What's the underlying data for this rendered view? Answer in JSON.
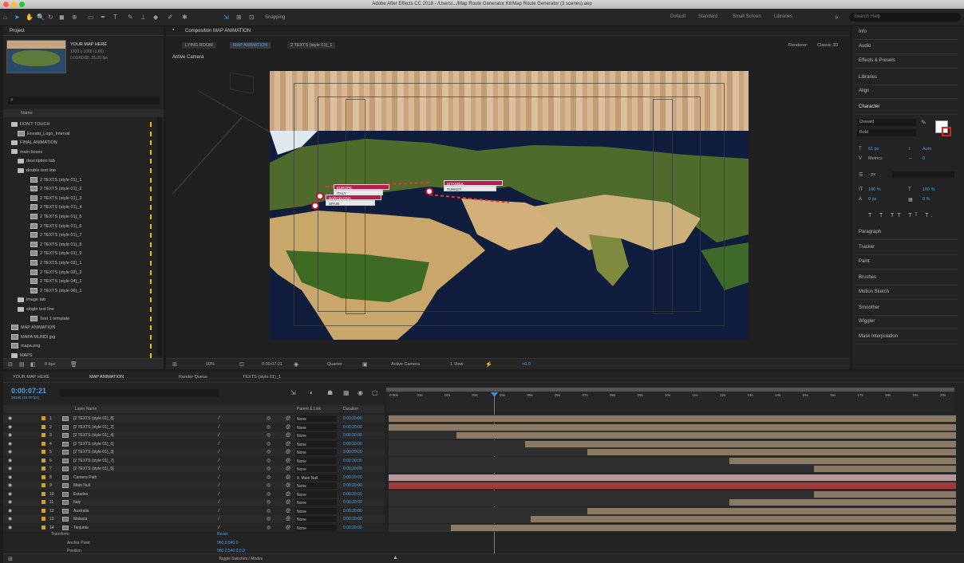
{
  "window": {
    "title": "Adobe After Effects CC 2018 - /Users/.../Map Route Generator Kit/Map Route Generator (3 scenes).aep"
  },
  "toolbar": {
    "snapping": "Snapping",
    "workspaces": [
      "Default",
      "Standard",
      "Small Screen",
      "Libraries"
    ],
    "search_placeholder": "Search Help"
  },
  "project": {
    "header": "Project",
    "thumb_title": "YOUR MAP HERE",
    "thumb_meta": "1920 x 1080 (1.00)",
    "thumb_meta2": "0:00:00:00, 25.00 fps",
    "col_name": "Name",
    "bpc": "8 bpc",
    "items": [
      {
        "type": "folder",
        "label": "DON'T TOUCH",
        "indent": 6
      },
      {
        "type": "comp",
        "label": "Envato_Logo_Interval",
        "indent": 14
      },
      {
        "type": "folder",
        "label": "FINAL ANIMATION",
        "indent": 6
      },
      {
        "type": "folder",
        "label": "main boxes",
        "indent": 6
      },
      {
        "type": "folder",
        "label": "description tab",
        "indent": 14
      },
      {
        "type": "folder",
        "label": "double text line",
        "indent": 14
      },
      {
        "type": "comp",
        "label": "2 TEXTS (style 01)_1",
        "indent": 30
      },
      {
        "type": "comp",
        "label": "2 TEXTS (style 01)_2",
        "indent": 30
      },
      {
        "type": "comp",
        "label": "2 TEXTS (style 01)_3",
        "indent": 30
      },
      {
        "type": "comp",
        "label": "2 TEXTS (style 01)_4",
        "indent": 30
      },
      {
        "type": "comp",
        "label": "2 TEXTS (style 01)_5",
        "indent": 30
      },
      {
        "type": "comp",
        "label": "2 TEXTS (style 01)_6",
        "indent": 30
      },
      {
        "type": "comp",
        "label": "2 TEXTS (style 01)_7",
        "indent": 30
      },
      {
        "type": "comp",
        "label": "2 TEXTS (style 01)_8",
        "indent": 30
      },
      {
        "type": "comp",
        "label": "2 TEXTS (style 01)_9",
        "indent": 30
      },
      {
        "type": "comp",
        "label": "2 TEXTS (style 02)_1",
        "indent": 30
      },
      {
        "type": "comp",
        "label": "2 TEXTS (style 02)_2",
        "indent": 30
      },
      {
        "type": "comp",
        "label": "2 TEXTS (style 04)_1",
        "indent": 30
      },
      {
        "type": "comp",
        "label": "2 TEXTS (style 06)_1",
        "indent": 30
      },
      {
        "type": "folder",
        "label": "image tab",
        "indent": 14
      },
      {
        "type": "folder",
        "label": "single text line",
        "indent": 14
      },
      {
        "type": "comp",
        "label": "Text 1 template",
        "indent": 30
      },
      {
        "type": "comp",
        "label": "MAP ANIMATION",
        "indent": 6
      },
      {
        "type": "comp",
        "label": "MAPA MUNDI.jpg",
        "indent": 6
      },
      {
        "type": "comp",
        "label": "mapa.png",
        "indent": 6
      },
      {
        "type": "folder",
        "label": "MAPS",
        "indent": 6
      }
    ]
  },
  "viewer": {
    "header": "Composition MAP ANIMATION",
    "crumbs": [
      "LYING ROOM",
      "MAP ANIMATION",
      "2 TEXTS (style 01)_1"
    ],
    "active_camera": "Active Camera",
    "renderer": "Renderer:",
    "renderer_value": "Classic 3D",
    "footer": {
      "zoom": "50%",
      "timecode": "0:00:07:21",
      "res": "Quarter",
      "camera": "Active Camera",
      "view": "1 View",
      "offset": "+0.0"
    },
    "tags": [
      {
        "label": "EUROPE",
        "sub": "ITALY"
      },
      {
        "label": "BARCELONA",
        "sub": "SPAIN"
      },
      {
        "label": "ISTANBUL",
        "sub": "TURKEY"
      }
    ]
  },
  "right": {
    "panels": [
      "Info",
      "Audio",
      "Effects & Presets",
      "Libraries",
      "Align",
      "Character",
      "Paragraph",
      "Tracker",
      "Paint",
      "Brushes",
      "Motion Sketch",
      "Smoother",
      "Wiggler",
      "Mask Interpolation"
    ],
    "font": "Oswald",
    "style": "Bold",
    "size": "61 px",
    "leading": "Auto",
    "kerning": "Metrics",
    "tracking": "0",
    "stroke": "- px",
    "vscale": "100 %",
    "hscale": "100 %",
    "baseline": "0 px",
    "tsume": "0 %"
  },
  "timeline": {
    "tabs": [
      "YOUR MAP HERE",
      "MAP ANIMATION",
      "Render Queue",
      "TEXTS (style 01)_1"
    ],
    "timecode": "0:00:07:21",
    "fps": "00196 (25.00 fps)",
    "col_layer": "Layer Name",
    "col_parent": "Parent & Link",
    "col_duration": "Duration",
    "toggle": "Toggle Switches / Modes",
    "ruler": [
      "0:00s",
      "01s",
      "02s",
      "03s",
      "04s",
      "05s",
      "06s",
      "07s",
      "08s",
      "09s",
      "10s",
      "11s",
      "12s",
      "13s",
      "14s",
      "15s",
      "16s",
      "17s",
      "18s",
      "19s",
      "20s"
    ],
    "layers": [
      {
        "n": "1",
        "name": "[2 TEXTS (style 01)_8]",
        "parent": "None",
        "dur": "0:00:20:00",
        "start": 0.0,
        "color": "#8a7a63"
      },
      {
        "n": "2",
        "name": "[2 TEXTS (style 01)_2]",
        "parent": "None",
        "dur": "0:00:20:00",
        "start": 0.0,
        "color": "#8a7a63"
      },
      {
        "n": "3",
        "name": "[2 TEXTS (style 01)_4]",
        "parent": "None",
        "dur": "0:00:20:00",
        "start": 0.12,
        "color": "#8a7a63"
      },
      {
        "n": "4",
        "name": "[2 TEXTS (style 01)_6]",
        "parent": "None",
        "dur": "0:00:20:00",
        "start": 0.24,
        "color": "#8a7a63"
      },
      {
        "n": "5",
        "name": "[2 TEXTS (style 01)_3]",
        "parent": "None",
        "dur": "0:00:20:00",
        "start": 0.35,
        "color": "#8a7a63"
      },
      {
        "n": "6",
        "name": "[2 TEXTS (style 01)_7]",
        "parent": "None",
        "dur": "0:00:20:00",
        "start": 0.6,
        "color": "#8a7a63"
      },
      {
        "n": "7",
        "name": "[2 TEXTS (style 01)_5]",
        "parent": "None",
        "dur": "0:00:20:00",
        "start": 0.75,
        "color": "#8a7a63"
      },
      {
        "n": "8",
        "name": "Camera Path",
        "parent": "9. Main Null",
        "dur": "0:00:20:00",
        "start": 0.0,
        "color": "#b8969a"
      },
      {
        "n": "9",
        "name": "Main Null",
        "parent": "None",
        "dur": "0:00:20:00",
        "start": 0.0,
        "color": "#a33a3a"
      },
      {
        "n": "10",
        "name": "Estados",
        "parent": "None",
        "dur": "0:00:20:00",
        "start": 0.75,
        "color": "#8a7a63"
      },
      {
        "n": "11",
        "name": "Italy",
        "parent": "None",
        "dur": "0:00:20:00",
        "start": 0.6,
        "color": "#8a7a63"
      },
      {
        "n": "12",
        "name": "Australia",
        "parent": "None",
        "dur": "0:00:20:00",
        "start": 0.35,
        "color": "#8a7a63"
      },
      {
        "n": "13",
        "name": "Malasia",
        "parent": "None",
        "dur": "0:00:20:00",
        "start": 0.25,
        "color": "#8a7a63"
      },
      {
        "n": "14",
        "name": "Tanjunia",
        "parent": "None",
        "dur": "0:00:20:00",
        "start": 0.11,
        "color": "#8a7a63"
      }
    ],
    "transform": "Transform",
    "reset": "Reset",
    "anchor": "Anchor Point",
    "anchor_val": "960.0,540.0",
    "position": "Position",
    "position_val": "960.0,540.0,0.0"
  }
}
